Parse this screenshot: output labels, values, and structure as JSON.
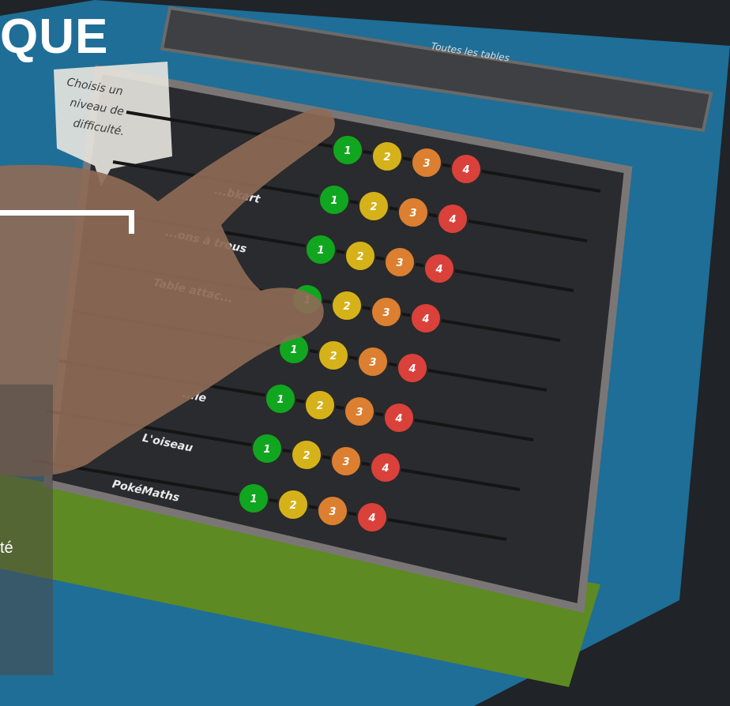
{
  "overlay": {
    "headline": "QUE",
    "panel_text": "té"
  },
  "game": {
    "top_bar_title": "Toutes les tables",
    "speech_bubble": [
      "Choisis un",
      "niveau de",
      "difficulté."
    ],
    "rows": [
      {
        "label": ""
      },
      {
        "label": "...bkart"
      },
      {
        "label": "...ons à trous"
      },
      {
        "label": "Table attac..."
      },
      {
        "label": ""
      },
      {
        "label": "...le"
      },
      {
        "label": "L'oiseau"
      },
      {
        "label": "PokéMaths"
      }
    ],
    "difficulty_levels": [
      {
        "label": "1",
        "color": "#11a61f"
      },
      {
        "label": "2",
        "color": "#d6b21a"
      },
      {
        "label": "3",
        "color": "#dc7f31"
      },
      {
        "label": "4",
        "color": "#d9413a"
      }
    ]
  }
}
